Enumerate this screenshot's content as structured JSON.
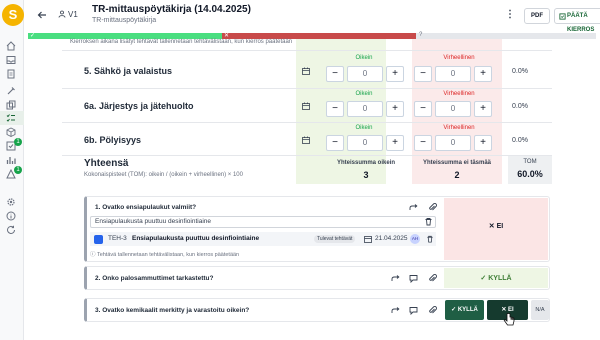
{
  "header": {
    "version": "V1",
    "title": "TR-mittauspöytäkirja (14.04.2025)",
    "subtitle": "TR-mittauspöytäkirja",
    "pdf_label": "PDF",
    "end_round_label": "PÄÄTÄ KIERROS"
  },
  "sidebar": {
    "logo": "S",
    "badges": [
      "1",
      "1"
    ]
  },
  "status_bar": {
    "ok_mark": "✓",
    "fail_mark": "✕",
    "unknown_mark": "?"
  },
  "score_table": {
    "top_hint": "Kierroksen aikana lisätyt tehtävät tallennetaan tehtävälistaan, kun kierros päätetään",
    "correct_label": "Oikein",
    "incorrect_label": "Virheellinen",
    "rows": [
      {
        "label": "5. Sähkö ja valaistus",
        "correct": "0",
        "incorrect": "0",
        "pct": "0.0%"
      },
      {
        "label": "6a. Järjestys ja jätehuolto",
        "correct": "0",
        "incorrect": "0",
        "pct": "0.0%"
      },
      {
        "label": "6b. Pölyisyys",
        "correct": "0",
        "incorrect": "0",
        "pct": "0.0%"
      }
    ],
    "total": {
      "title": "Yhteensä",
      "subtitle": "Kokonaispisteet (TOM): oikein / (oikein + virheellinen) × 100",
      "correct_sum_label": "Yhteissumma oikein",
      "correct_sum": "3",
      "incorrect_sum_label": "Yhteissumma ei täsmää",
      "incorrect_sum": "2",
      "tom_label": "TOM",
      "tom_value": "60.0%"
    }
  },
  "questions": [
    {
      "title": "1. Ovatko ensiapulaukut valmiit?",
      "answer": "EI",
      "note": "Ensiapulaukusta puuttuu desinfiointiaine",
      "task": {
        "id": "TEH-3",
        "text": "Ensiapulaukusta puuttuu desinfiointiaine",
        "chip": "Tulevat tehtävät",
        "date": "21.04.2025",
        "avatar": "AH"
      },
      "saved_note": "Tehtävä tallennetaan tehtävälistaan, kun kierros päätetään"
    },
    {
      "title": "2. Onko palosammuttimet tarkastettu?",
      "answer": "KYLLÄ"
    },
    {
      "title": "3. Ovatko kemikaalit merkitty ja varastoitu oikein?",
      "btn_yes": "KYLLÄ",
      "btn_no": "EI",
      "btn_na": "N/A"
    }
  ],
  "colors": {
    "brand": "#f5b400",
    "accent_green": "#1f5e44",
    "correct_bg": "#eef6e4",
    "incorrect_bg": "#fbeaea",
    "status_green": "#4ade80",
    "status_red": "#c84a4a"
  }
}
